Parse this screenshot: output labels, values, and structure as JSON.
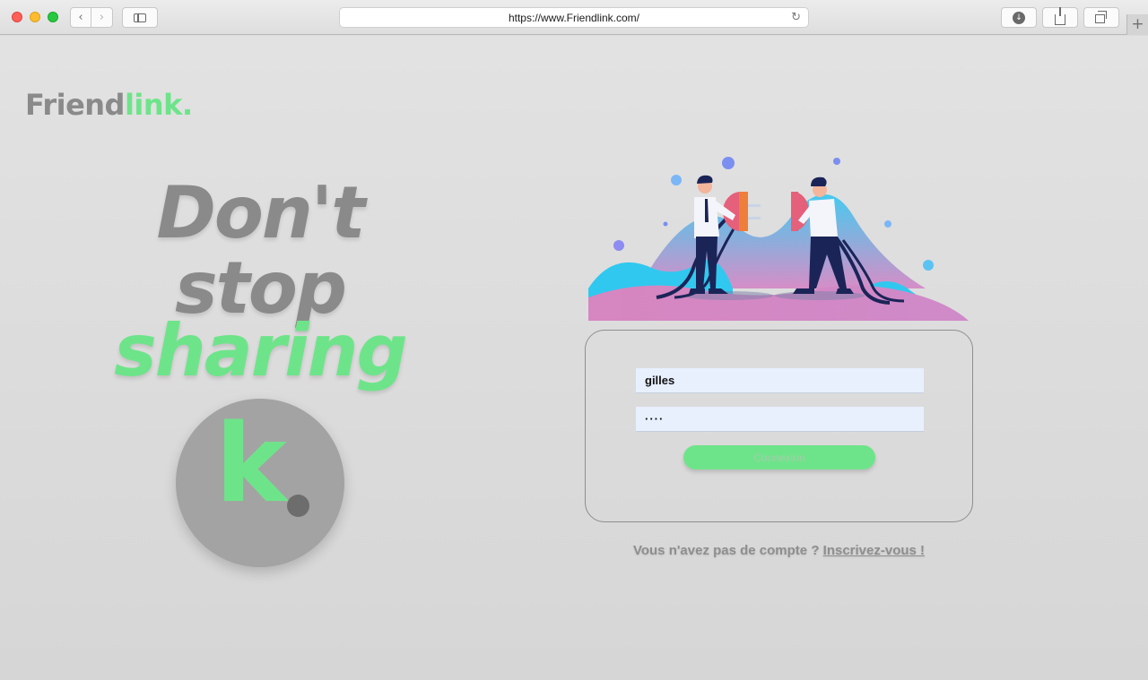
{
  "browser": {
    "url": "https://www.Friendlink.com/",
    "back_icon": "chevron-left-icon",
    "forward_icon": "chevron-right-icon",
    "new_tab_glyph": "+",
    "reload_glyph": "↻",
    "download_glyph": "↓",
    "back_glyph": "‹",
    "forward_glyph": "›"
  },
  "brand": {
    "name_part1": "Friend",
    "name_part2": "link.",
    "accent_color": "#6ee48a",
    "grey_color": "#8a8a8a"
  },
  "hero": {
    "line1": "Don't",
    "line2": "stop",
    "line3": "sharing",
    "badge_letter": "k"
  },
  "login": {
    "username_value": "gilles",
    "password_value": "····",
    "submit_label": "Connexion"
  },
  "signup": {
    "prompt": "Vous n'avez pas de compte ? ",
    "link_text": "Inscrivez-vous !"
  }
}
